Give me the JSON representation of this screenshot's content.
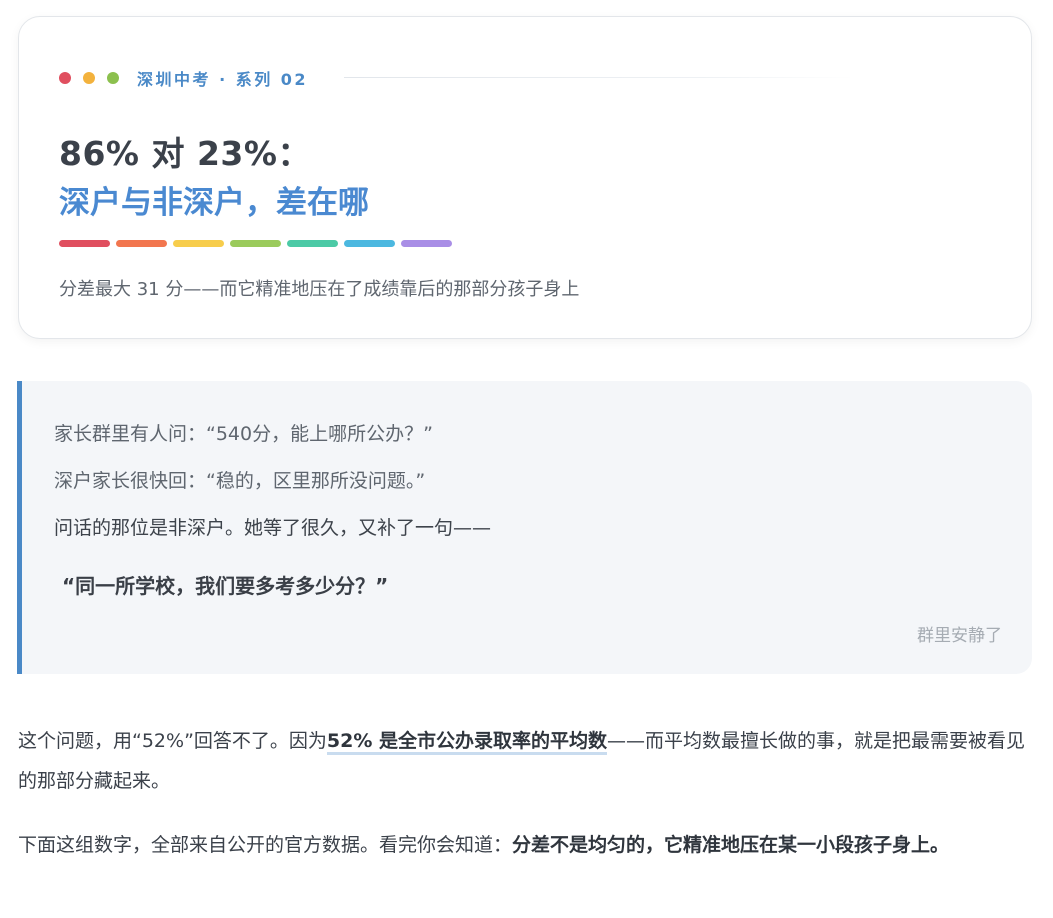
{
  "header": {
    "dots": [
      "#e04f5f",
      "#f3b23d",
      "#8cc04e"
    ],
    "eyebrow": "深圳中考 · 系列 02",
    "title_line1": "86% 对 23%：",
    "title_line2": "深户与非深户，差在哪",
    "rainbow": [
      "#e04f5f",
      "#f2764f",
      "#f7cd4c",
      "#9bcb5c",
      "#4ccaa6",
      "#4cb8e0",
      "#a98ee6"
    ],
    "subtitle": "分差最大 31 分——而它精准地压在了成绩靠后的那部分孩子身上"
  },
  "quote": {
    "line1": "家长群里有人问：“540分，能上哪所公办？”",
    "line2": "深户家长很快回：“稳的，区里那所没问题。”",
    "line3": "问话的那位是非深户。她等了很久，又补了一句——",
    "strong": "“同一所学校，我们要多考多少分？”",
    "note": "群里安静了"
  },
  "body": {
    "p1_a": "这个问题，用“52%”回答不了。因为",
    "p1_em": "52% 是全市公办录取率的平均数",
    "p1_b": "——而平均数最擅长做的事，就是把最需要被看见的那部分藏起来。",
    "p2_a": "下面这组数字，全部来自公开的官方数据。看完你会知道：",
    "p2_em": "分差不是均匀的，它精准地压在某一小段孩子身上。"
  },
  "colors": {
    "accent": "#4a89c7",
    "title_blue": "#4a89d1",
    "quote_bg": "#f4f6f9"
  }
}
